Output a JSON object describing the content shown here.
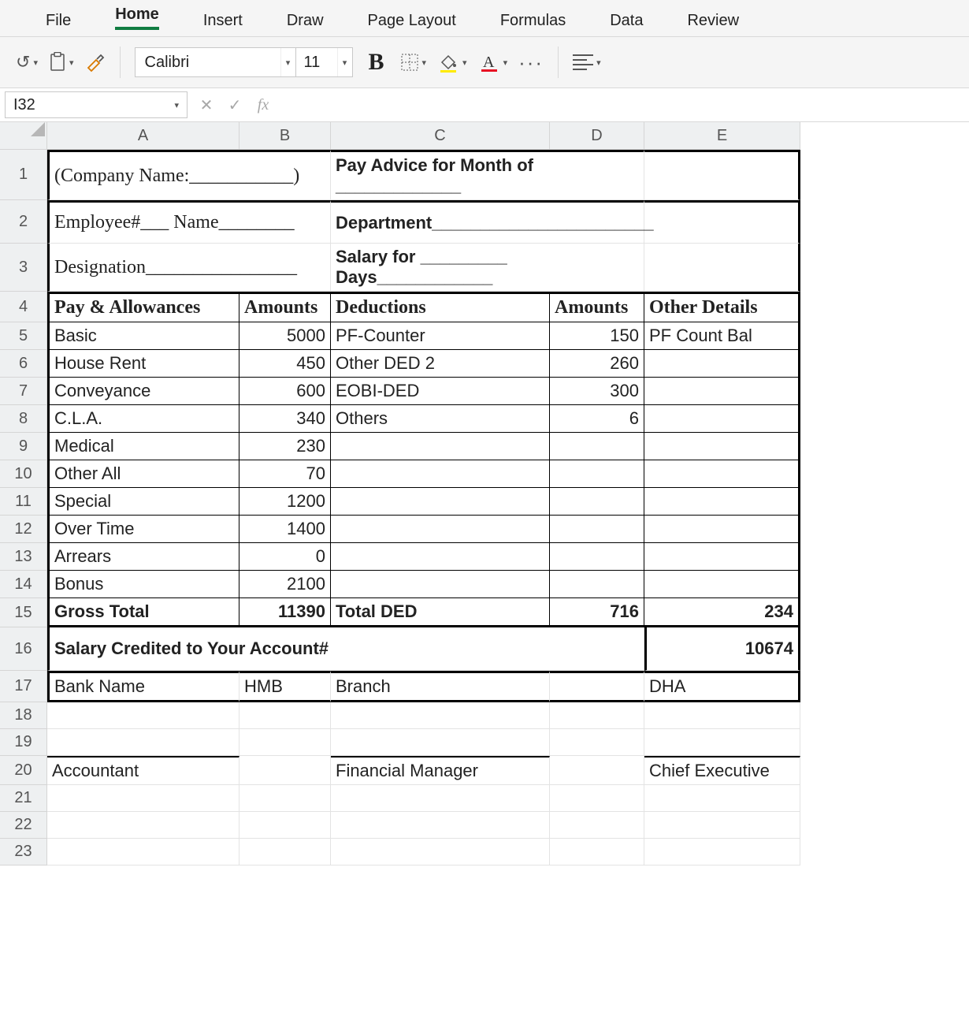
{
  "ribbon": {
    "tabs": [
      "File",
      "Home",
      "Insert",
      "Draw",
      "Page Layout",
      "Formulas",
      "Data",
      "Review"
    ],
    "active_index": 1
  },
  "toolbar": {
    "font_name": "Calibri",
    "font_size": "11"
  },
  "formula_bar": {
    "cell_ref": "I32",
    "fx_label": "fx"
  },
  "columns": [
    "A",
    "B",
    "C",
    "D",
    "E"
  ],
  "row_numbers": [
    "1",
    "2",
    "3",
    "4",
    "5",
    "6",
    "7",
    "8",
    "9",
    "10",
    "11",
    "12",
    "13",
    "14",
    "15",
    "16",
    "17",
    "18",
    "19",
    "20",
    "21",
    "22",
    "23"
  ],
  "doc": {
    "r1_a": "(Company Name:___________)",
    "r1_c": "Pay Advice for Month of _____________",
    "r2_a": "Employee#___  Name________",
    "r2_c": "Department_______________________",
    "r3_a": "Designation________________",
    "r3_c": "Salary for _________ Days____________",
    "hdr_pay": "Pay & Allowances",
    "hdr_amt1": "Amounts",
    "hdr_ded": "Deductions",
    "hdr_amt2": "Amounts",
    "hdr_other": "Other Details",
    "rows": [
      {
        "pay": "Basic",
        "amt1": "5000",
        "ded": "PF-Counter",
        "amt2": "150",
        "other": "PF Count Bal"
      },
      {
        "pay": "House Rent",
        "amt1": "450",
        "ded": "Other DED 2",
        "amt2": "260",
        "other": ""
      },
      {
        "pay": "Conveyance",
        "amt1": "600",
        "ded": "EOBI-DED",
        "amt2": "300",
        "other": ""
      },
      {
        "pay": "C.L.A.",
        "amt1": "340",
        "ded": "Others",
        "amt2": "6",
        "other": ""
      },
      {
        "pay": "Medical",
        "amt1": "230",
        "ded": "",
        "amt2": "",
        "other": ""
      },
      {
        "pay": "Other All",
        "amt1": "70",
        "ded": "",
        "amt2": "",
        "other": ""
      },
      {
        "pay": "Special",
        "amt1": "1200",
        "ded": "",
        "amt2": "",
        "other": ""
      },
      {
        "pay": "Over Time",
        "amt1": "1400",
        "ded": "",
        "amt2": "",
        "other": ""
      },
      {
        "pay": "Arrears",
        "amt1": "0",
        "ded": "",
        "amt2": "",
        "other": ""
      },
      {
        "pay": "Bonus",
        "amt1": "2100",
        "ded": "",
        "amt2": "",
        "other": ""
      }
    ],
    "gross_label": "Gross Total",
    "gross_amt": "11390",
    "total_ded_label": "Total DED",
    "total_ded_amt": "716",
    "total_other": "234",
    "credited_label": "Salary Credited to Your Account#",
    "credited_amt": "10674",
    "bank_label": "Bank Name",
    "bank_name": "HMB",
    "branch_label": "Branch",
    "branch_name": "DHA",
    "sig1": "Accountant",
    "sig2": "Financial Manager",
    "sig3": "Chief Executive"
  },
  "chart_data": {
    "type": "table",
    "title": "Pay Advice",
    "pay_and_allowances": [
      {
        "item": "Basic",
        "amount": 5000
      },
      {
        "item": "House Rent",
        "amount": 450
      },
      {
        "item": "Conveyance",
        "amount": 600
      },
      {
        "item": "C.L.A.",
        "amount": 340
      },
      {
        "item": "Medical",
        "amount": 230
      },
      {
        "item": "Other All",
        "amount": 70
      },
      {
        "item": "Special",
        "amount": 1200
      },
      {
        "item": "Over Time",
        "amount": 1400
      },
      {
        "item": "Arrears",
        "amount": 0
      },
      {
        "item": "Bonus",
        "amount": 2100
      }
    ],
    "gross_total": 11390,
    "deductions": [
      {
        "item": "PF-Counter",
        "amount": 150
      },
      {
        "item": "Other DED 2",
        "amount": 260
      },
      {
        "item": "EOBI-DED",
        "amount": 300
      },
      {
        "item": "Others",
        "amount": 6
      }
    ],
    "total_deductions": 716,
    "other_details_total": 234,
    "net_credited": 10674,
    "bank": "HMB",
    "branch": "DHA"
  }
}
